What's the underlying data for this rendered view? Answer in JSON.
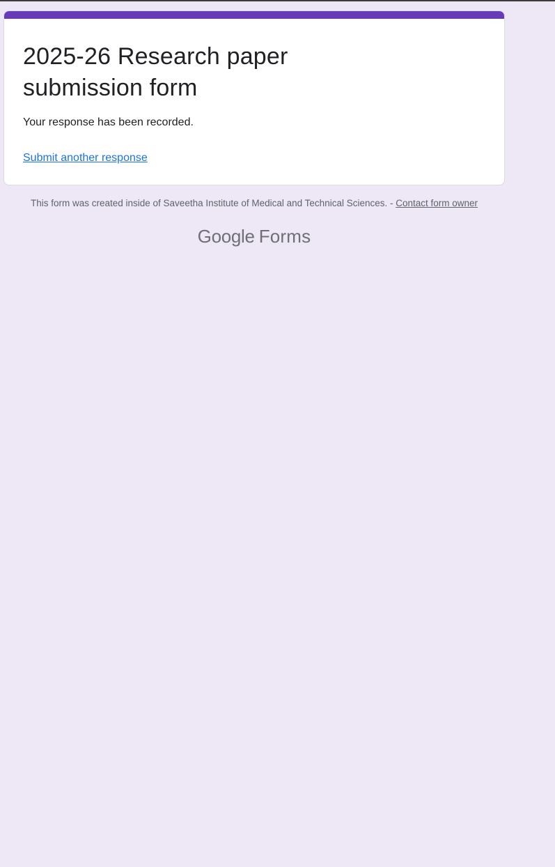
{
  "form": {
    "title": "2025-26 Research paper submission form",
    "confirmation": "Your response has been recorded.",
    "submit_another_label": "Submit another response"
  },
  "footer": {
    "created_inside_text": "This form was created inside of Saveetha Institute of Medical and Technical Sciences. - ",
    "contact_owner_label": "Contact form owner"
  },
  "branding": {
    "google_label": "Google",
    "forms_label": "Forms"
  },
  "colors": {
    "page_background": "#ede7f6",
    "accent": "#673ab7",
    "link": "#1a73e8"
  }
}
